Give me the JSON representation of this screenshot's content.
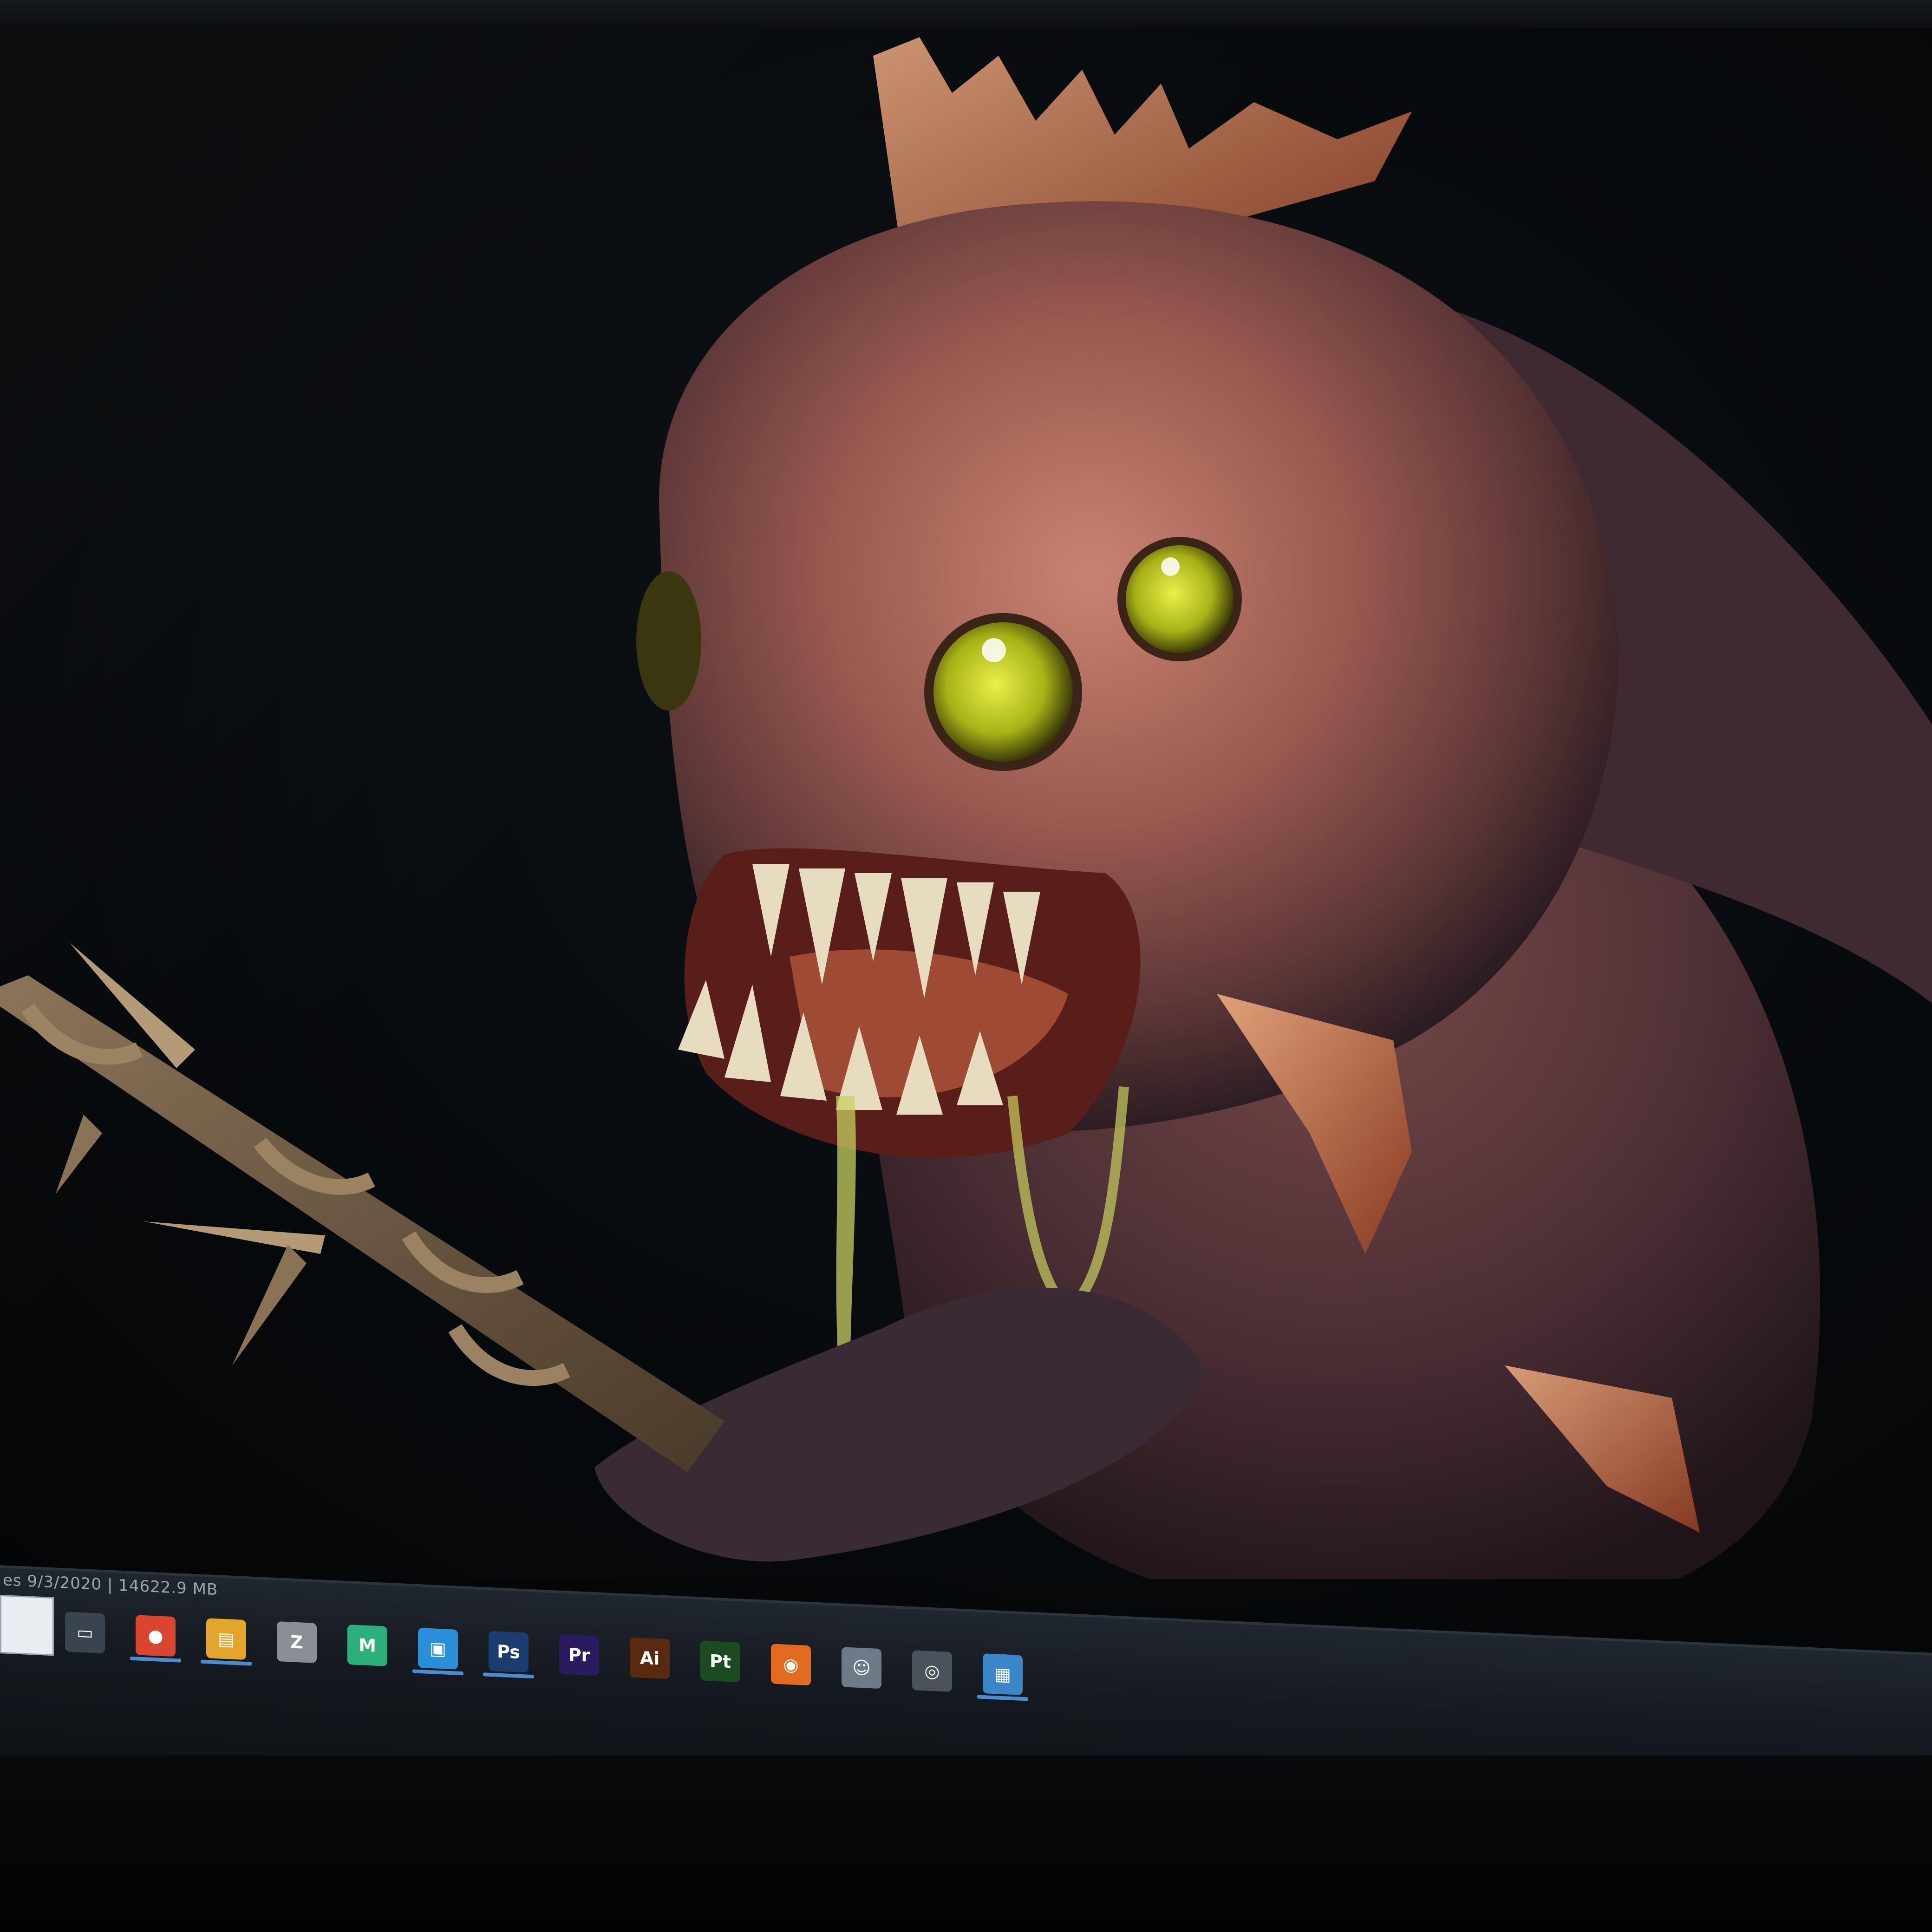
{
  "window": {
    "status_text": "es 9/3/2020 | 14622.9 MB"
  },
  "artwork": {
    "subject": "fish-creature-with-spear",
    "eye_color": "#c9d41a",
    "skin_color": "#b06a5c"
  },
  "taskbar": {
    "icons": [
      {
        "name": "task-view-icon",
        "glyph": "▭",
        "color": "#3a4450"
      },
      {
        "name": "chrome-icon",
        "glyph": "●",
        "color": "#d9452f"
      },
      {
        "name": "file-explorer-icon",
        "glyph": "▤",
        "color": "#e3a52b"
      },
      {
        "name": "zbrush-icon",
        "glyph": "Z",
        "color": "#8a8f96"
      },
      {
        "name": "marmoset-icon",
        "glyph": "M",
        "color": "#2bb07a"
      },
      {
        "name": "store-icon",
        "glyph": "▣",
        "color": "#2a8fd8"
      },
      {
        "name": "photoshop-icon",
        "glyph": "Ps",
        "color": "#1b3c6e"
      },
      {
        "name": "premiere-icon",
        "glyph": "Pr",
        "color": "#2a1b5e"
      },
      {
        "name": "illustrator-icon",
        "glyph": "Ai",
        "color": "#5a2a10"
      },
      {
        "name": "substance-icon",
        "glyph": "Pt",
        "color": "#1c4a22"
      },
      {
        "name": "blender-icon",
        "glyph": "◉",
        "color": "#e36b1f"
      },
      {
        "name": "discord-icon",
        "glyph": "☺",
        "color": "#6d7a88"
      },
      {
        "name": "obs-icon",
        "glyph": "◎",
        "color": "#4a525c"
      },
      {
        "name": "monitor-app-icon",
        "glyph": "▦",
        "color": "#3b86c9"
      }
    ]
  }
}
